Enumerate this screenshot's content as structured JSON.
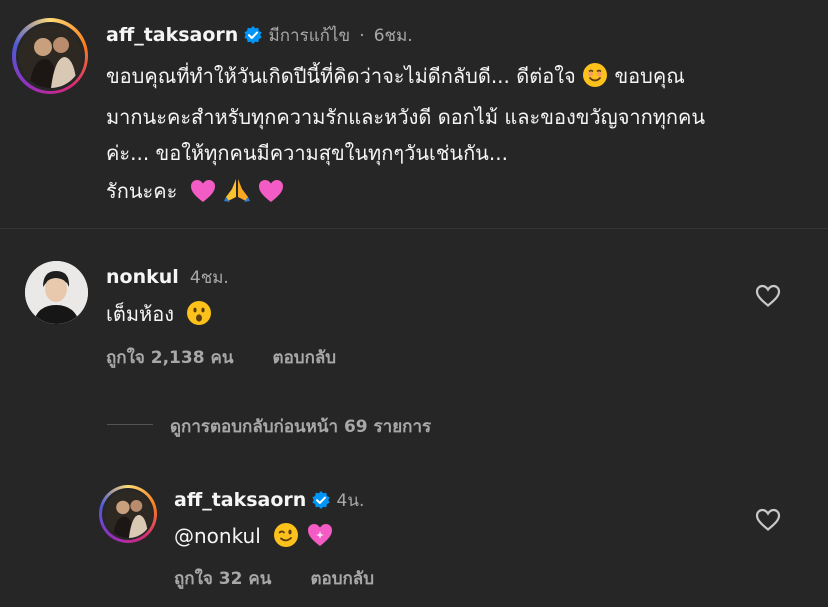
{
  "post": {
    "username": "aff_taksaorn",
    "edited_label": "มีการแก้ไข",
    "dot": "·",
    "time": "6ชม.",
    "caption_line1": "ขอบคุณที่ทำให้วันเกิดปีนี้ที่คิดว่าจะไม่ดีกลับดี... ดีต่อใจ",
    "caption_line1b": "ขอบคุณ",
    "caption_line2": "มากนะคะสำหรับทุกความรักและหวังดี ดอกไม้ และของขวัญจากทุกคน",
    "caption_line3": "ค่ะ... ขอให้ทุกคนมีความสุขในทุกๆวันเช่นกัน...",
    "caption_line4": "รักนะคะ"
  },
  "comment": {
    "username": "nonkul",
    "time": "4ชม.",
    "text": "เต็มห้อง",
    "likes": "ถูกใจ 2,138 คน",
    "reply_label": "ตอบกลับ"
  },
  "view_replies": "ดูการตอบกลับก่อนหน้า 69 รายการ",
  "reply": {
    "username": "aff_taksaorn",
    "time": "4น.",
    "text": "@nonkul",
    "likes": "ถูกใจ 32 คน",
    "reply_label": "ตอบกลับ"
  },
  "colors": {
    "background": "#262626",
    "verified": "#0095f6",
    "muted": "#a8a8a8"
  }
}
